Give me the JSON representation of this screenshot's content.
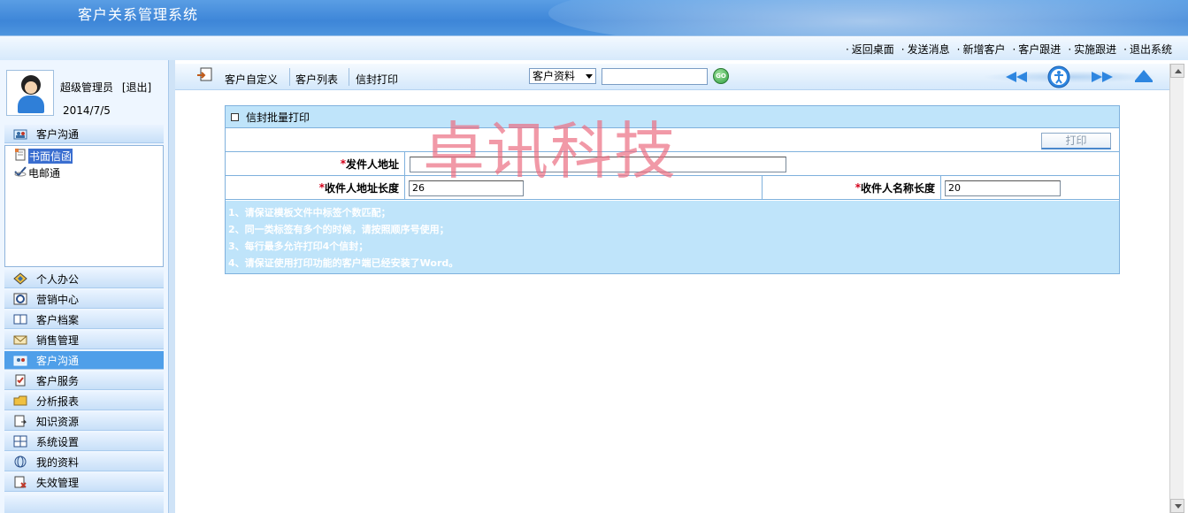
{
  "app": {
    "title": "客户关系管理系统"
  },
  "topnav": {
    "links": [
      "返回桌面",
      "发送消息",
      "新增客户",
      "客户跟进",
      "实施跟进",
      "退出系统"
    ]
  },
  "user": {
    "name": "超级管理员",
    "logout": "[退出]",
    "date": "2014/7/5"
  },
  "sidebar": {
    "current_section": "客户沟通",
    "sub_items": [
      {
        "label": "书面信函",
        "selected": true
      },
      {
        "label": "电邮通",
        "selected": false
      }
    ],
    "sections": [
      {
        "label": "个人办公",
        "icon": "diamond-icon"
      },
      {
        "label": "营销中心",
        "icon": "chart-icon"
      },
      {
        "label": "客户档案",
        "icon": "book-icon"
      },
      {
        "label": "销售管理",
        "icon": "envelope-icon"
      },
      {
        "label": "客户沟通",
        "icon": "people-icon",
        "active": true
      },
      {
        "label": "客户服务",
        "icon": "clipboard-icon"
      },
      {
        "label": "分析报表",
        "icon": "folder-icon"
      },
      {
        "label": "知识资源",
        "icon": "document-icon"
      },
      {
        "label": "系统设置",
        "icon": "grid-icon"
      },
      {
        "label": "我的资料",
        "icon": "globe-icon"
      },
      {
        "label": "失效管理",
        "icon": "file-x-icon"
      }
    ]
  },
  "toolbar": {
    "items": [
      "客户自定义",
      "客户列表",
      "信封打印"
    ],
    "select_value": "客户资料",
    "search_value": "",
    "go_label": "GO"
  },
  "panel": {
    "title": "信封批量打印",
    "print_button": "打印",
    "sender_address_label": "发件人地址",
    "sender_address_value": "",
    "recipient_address_length_label": "收件人地址长度",
    "recipient_address_length_value": "26",
    "recipient_name_length_label": "收件人名称长度",
    "recipient_name_length_value": "20",
    "notes": [
      "1、请保证模板文件中标签个数匹配；",
      "2、同一类标签有多个的时候，请按照顺序号使用；",
      "3、每行最多允许打印4个信封；",
      "4、请保证使用打印功能的客户端已经安装了Word。"
    ]
  },
  "watermark": "卓讯科技",
  "colors": {
    "header": "#3d86d8",
    "panel_bg": "#bfe4fa",
    "active_section": "#4f9fe9",
    "required": "#d4001a"
  }
}
